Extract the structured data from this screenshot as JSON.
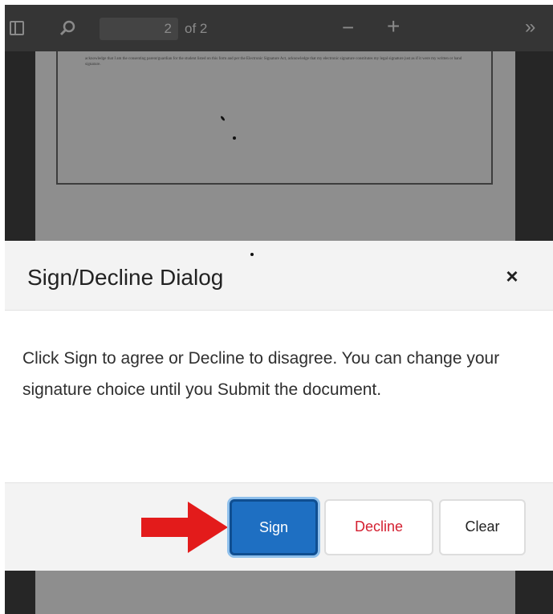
{
  "viewer": {
    "page_number": "2",
    "page_total": "of 2",
    "icons": [
      "sidebar-toggle-icon",
      "search-icon",
      "zoom-out-icon",
      "zoom-in-icon",
      "more-tools-icon"
    ],
    "doc_text": "acknowledge that I am the consenting parent/guardian for the student listed on this form and per the Electronic Signature Act, acknowledge that my electronic signature constitutes my legal signature just as if it were my written or hand signature."
  },
  "dialog": {
    "title": "Sign/Decline Dialog",
    "message": "Click Sign to agree or Decline to disagree. You can change your signature choice until you Submit the document.",
    "buttons": {
      "sign": "Sign",
      "decline": "Decline",
      "clear": "Clear"
    }
  },
  "colors": {
    "sign_button": "#1e6fc2",
    "decline_text": "#d41f30",
    "arrow": "#e31b1b",
    "viewer_bg": "#262626"
  }
}
